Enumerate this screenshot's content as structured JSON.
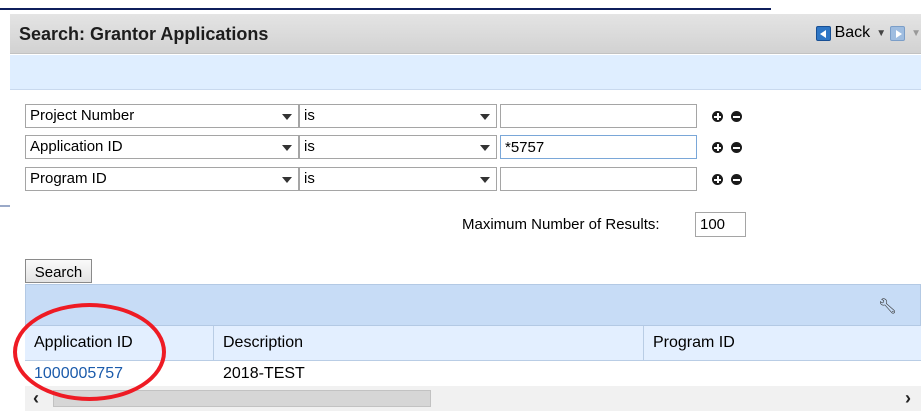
{
  "header": {
    "title": "Search: Grantor Applications",
    "back_label": "Back"
  },
  "criteria": [
    {
      "field": "Project Number",
      "operator": "is",
      "value": ""
    },
    {
      "field": "Application ID",
      "operator": "is",
      "value": "*5757"
    },
    {
      "field": "Program ID",
      "operator": "is",
      "value": ""
    }
  ],
  "max_results": {
    "label": "Maximum Number of Results:",
    "value": "100"
  },
  "search_label": "Search",
  "results": {
    "columns": [
      "Application ID",
      "Description",
      "Program ID"
    ],
    "rows": [
      {
        "application_id": "1000005757",
        "description": "2018-TEST",
        "program_id": ""
      }
    ]
  },
  "colors": {
    "link": "#1b5bab",
    "annotation_circle": "#ee1b24",
    "toolbar_bg": "#c7dcf6"
  },
  "icons": [
    "back-arrow-icon",
    "forward-arrow-icon",
    "add-criteria-icon",
    "remove-criteria-icon",
    "settings-wrench-icon",
    "dropdown-arrow-icon"
  ]
}
